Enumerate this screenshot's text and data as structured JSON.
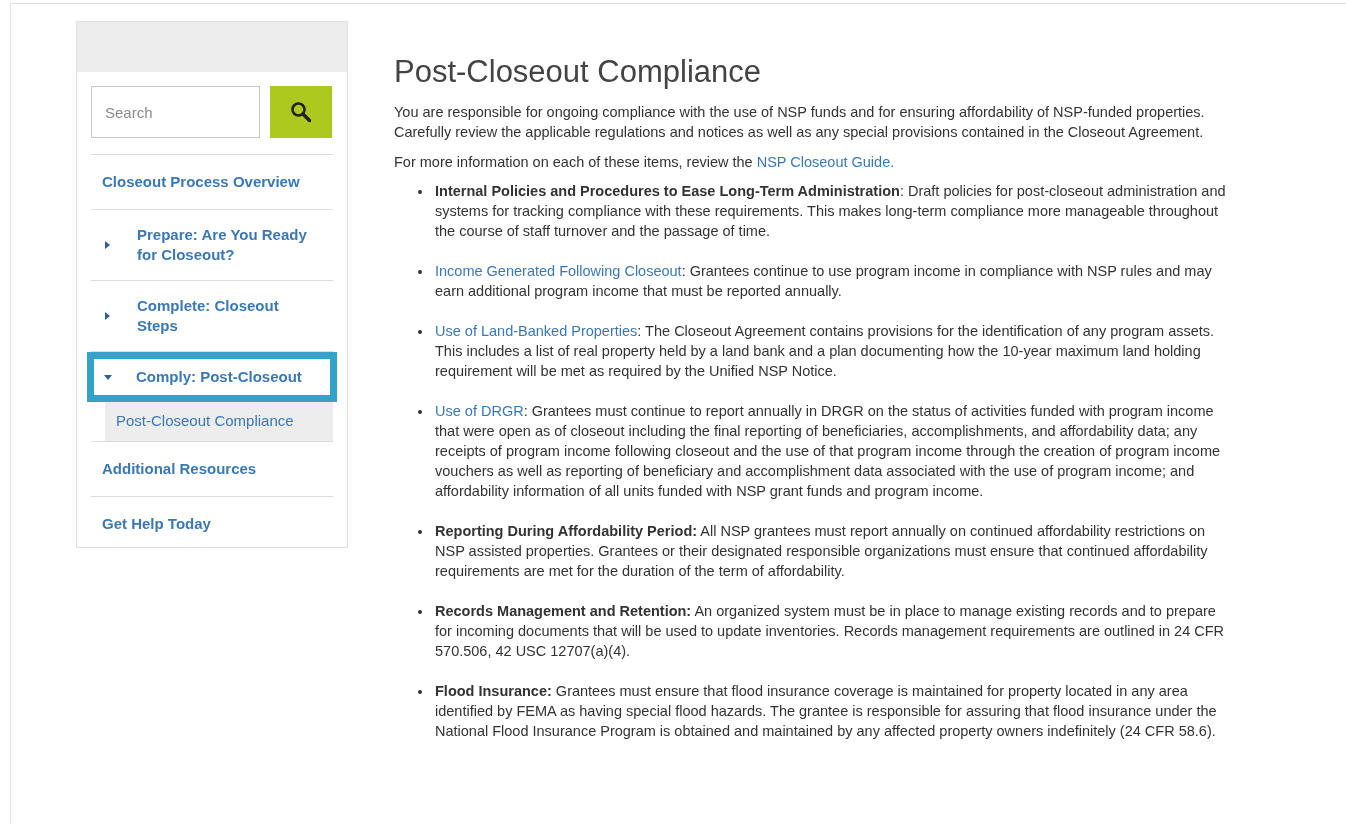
{
  "sidebar": {
    "search": {
      "placeholder": "Search"
    },
    "items": [
      {
        "label": "Closeout Process Overview",
        "kind": "link"
      },
      {
        "label": "Prepare: Are You Ready for Closeout?",
        "kind": "expandable",
        "expanded": false,
        "focused": false
      },
      {
        "label": "Complete: Closeout Steps",
        "kind": "expandable",
        "expanded": false,
        "focused": false
      },
      {
        "label": "Comply: Post-Closeout",
        "kind": "expandable",
        "expanded": true,
        "focused": true,
        "children": [
          {
            "label": "Post-Closeout Compliance",
            "selected": true
          }
        ]
      },
      {
        "label": "Additional Resources",
        "kind": "link"
      },
      {
        "label": "Get Help Today",
        "kind": "link"
      }
    ]
  },
  "content": {
    "title": "Post-Closeout Compliance",
    "intro": "You are responsible for ongoing compliance with the use of NSP funds and for ensuring affordability of NSP-funded properties. Carefully review the applicable regulations and notices as well as any special provisions contained in the Closeout Agreement.",
    "more_info": {
      "text": "For more information on each of these items, review the",
      "link": "NSP Closeout Guide."
    },
    "items": [
      {
        "kind": "bold",
        "lead": "Internal Policies and Procedures to Ease Long-Term Administration",
        "text": ": Draft policies for post-closeout administration and systems for tracking compliance with these requirements. This makes long-term compliance more manageable throughout the course of staff turnover and the passage of time."
      },
      {
        "kind": "link",
        "lead": "Income Generated Following Closeout",
        "text": ": Grantees continue to use program income in compliance with NSP rules and may earn additional program income that must be reported annually."
      },
      {
        "kind": "link",
        "lead": "Use of Land-Banked Properties",
        "text": ": The Closeout Agreement contains provisions for the identification of any program assets. This includes a list of real property held by a land bank and a plan documenting how the 10-year maximum land holding requirement will be met as required by the Unified NSP Notice."
      },
      {
        "kind": "link",
        "lead": "Use of DRGR",
        "text": ": Grantees must continue to report annually in DRGR on the status of activities funded with program income that were open as of closeout including the final reporting of beneficiaries, accomplishments, and affordability data; any receipts of program income following closeout and the use of that program income through the creation of program income vouchers as well as reporting of beneficiary and accomplishment data associated with the use of program income; and affordability information of all units funded with NSP grant funds and program income."
      },
      {
        "kind": "bold",
        "lead": "Reporting During Affordability Period:",
        "text": " All NSP grantees must report annually on continued affordability restrictions on NSP assisted properties. Grantees or their designated responsible organizations must ensure that continued affordability requirements are met for the duration of the term of affordability."
      },
      {
        "kind": "bold",
        "lead": "Records Management and Retention:",
        "text": " An organized system must be in place to manage existing records and to prepare for incoming documents that will be used to update inventories. Records management requirements are outlined in 24 CFR 570.506, 42 USC 12707(a)(4)."
      },
      {
        "kind": "bold",
        "lead": "Flood Insurance:",
        "text": " Grantees must ensure that flood insurance coverage is maintained for property located in any area identified by FEMA as having special flood hazards. The grantee is responsible for assuring that flood insurance under the National Flood Insurance Program is obtained and maintained by any affected property owners indefinitely (24 CFR 58.6)."
      }
    ]
  }
}
